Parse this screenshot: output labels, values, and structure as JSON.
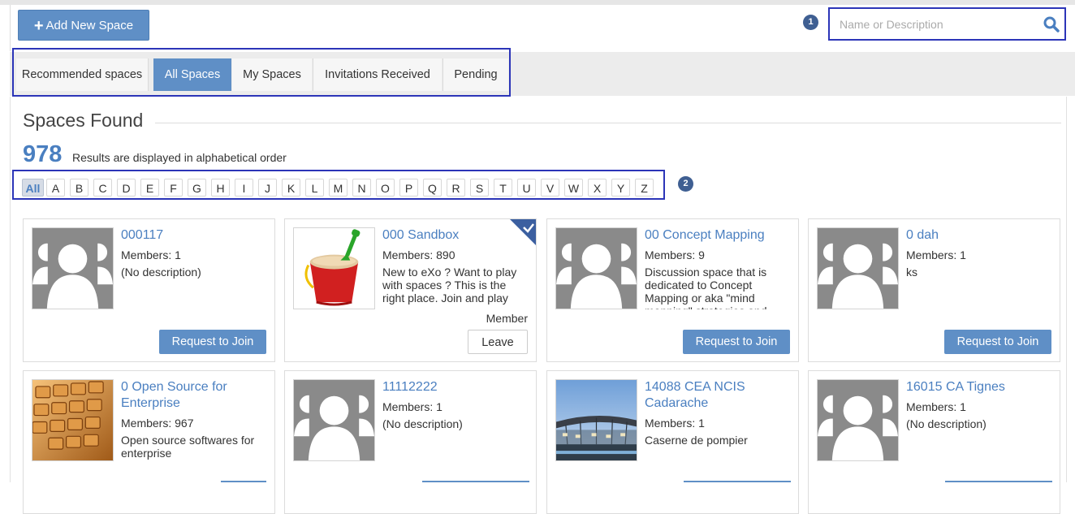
{
  "header": {
    "add_button_label": "Add New Space",
    "add_icon": "plus-icon",
    "badge_1": "1",
    "badge_2": "2"
  },
  "search": {
    "placeholder": "Name or Description",
    "value": "",
    "icon": "search-icon"
  },
  "tabs": [
    {
      "label": "Recommended spaces",
      "active": false
    },
    {
      "label": "All Spaces",
      "active": true
    },
    {
      "label": "My Spaces",
      "active": false
    },
    {
      "label": "Invitations Received",
      "active": false
    },
    {
      "label": "Pending",
      "active": false
    }
  ],
  "results": {
    "title": "Spaces Found",
    "count": "978",
    "note": "Results are displayed in alphabetical order"
  },
  "alphabet": [
    "All",
    "A",
    "B",
    "C",
    "D",
    "E",
    "F",
    "G",
    "H",
    "I",
    "J",
    "K",
    "L",
    "M",
    "N",
    "O",
    "P",
    "Q",
    "R",
    "S",
    "T",
    "U",
    "V",
    "W",
    "X",
    "Y",
    "Z"
  ],
  "alphabet_selected": "All",
  "spaces": [
    {
      "name": "000117",
      "members": "Members: 1",
      "description": "(No description)",
      "action": "Request to Join",
      "image": "default-avatar"
    },
    {
      "name": "000 Sandbox",
      "members": "Members: 890",
      "description": "New to eXo ? Want to play with spaces ? This is the right place. Join and play around as you wish",
      "action": "Leave",
      "status": "Member",
      "image": "sand-bucket"
    },
    {
      "name": "00 Concept Mapping",
      "members": "Members: 9",
      "description": "Discussion space that is dedicated to Concept Mapping or aka \"mind mapping\" strategies and",
      "action": "Request to Join",
      "image": "default-avatar"
    },
    {
      "name": "0 dah",
      "members": "Members: 1",
      "description": "ks",
      "action": "Request to Join",
      "image": "default-avatar"
    },
    {
      "name": "0 Open Source for Enterprise",
      "members": "Members: 967",
      "description": "Open source softwares for enterprise",
      "image": "keyboard"
    },
    {
      "name": "11112222",
      "members": "Members: 1",
      "description": "(No description)",
      "image": "default-avatar"
    },
    {
      "name": "14088 CEA NCIS Cadarache",
      "members": "Members: 1",
      "description": "Caserne de pompier",
      "image": "building-photo"
    },
    {
      "name": "16015 CA Tignes",
      "members": "Members: 1",
      "description": "(No description)",
      "image": "default-avatar"
    }
  ],
  "colors": {
    "accent": "#5f8fc6",
    "link": "#4a7fc0",
    "highlight_frame": "#2c35b8",
    "badge": "#3f5f92"
  }
}
